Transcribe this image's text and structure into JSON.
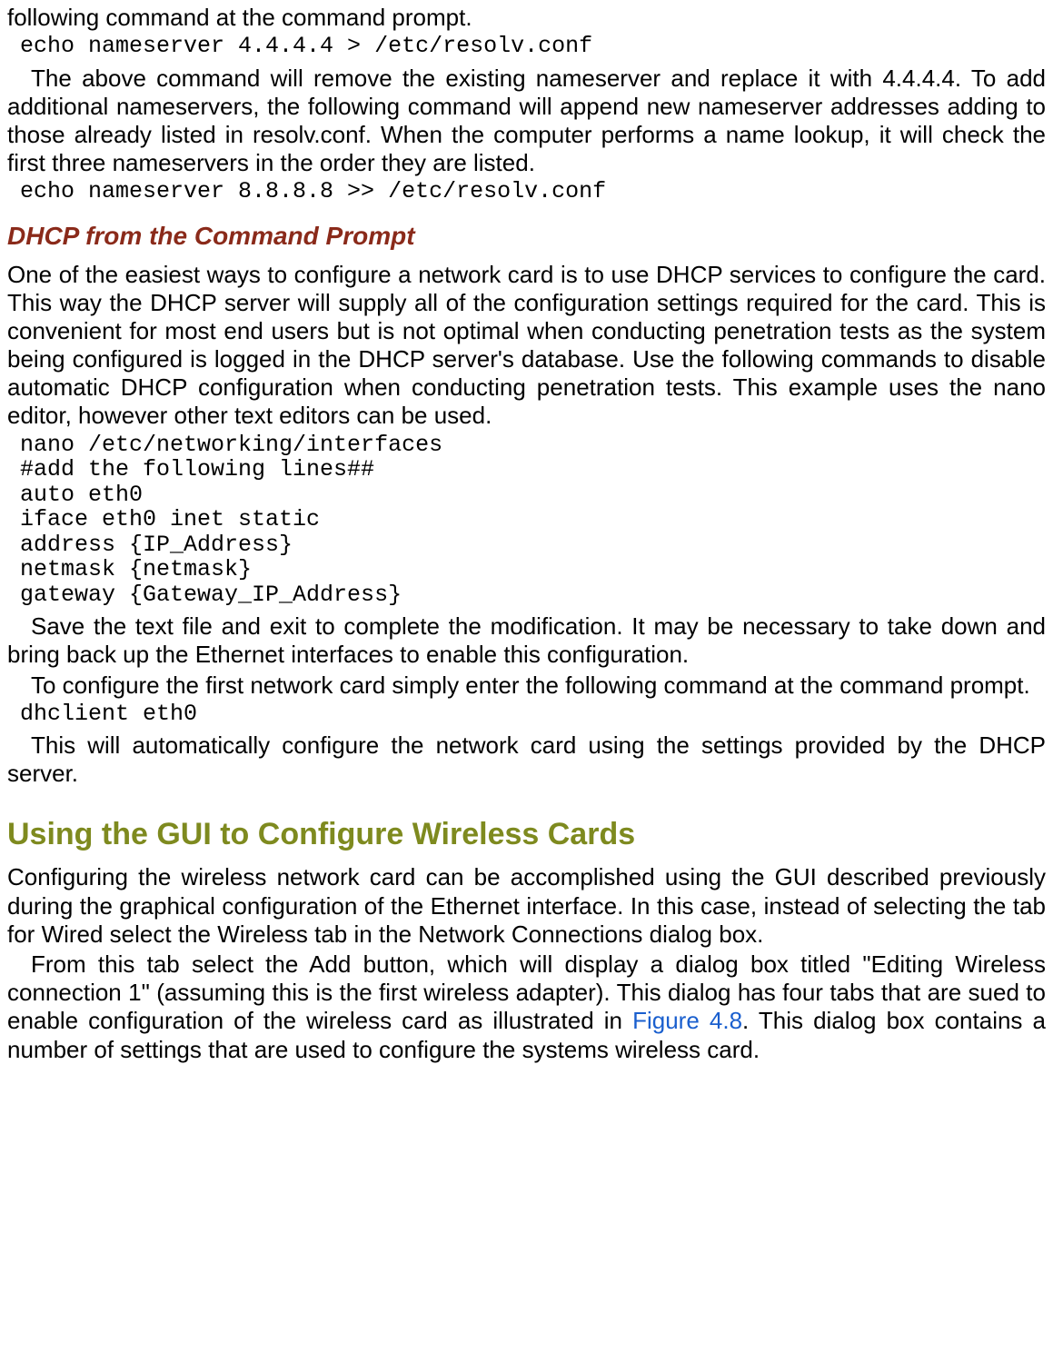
{
  "intro": {
    "p1": "following command at the command prompt.",
    "code1": "echo nameserver 4.4.4.4 > /etc/resolv.conf",
    "p2": "The above command will remove the existing nameserver and replace it with 4.4.4.4. To add additional nameservers, the following command will append new nameserver addresses adding to those already listed in resolv.conf. When the computer performs a name lookup, it will check the first three nameservers in the order they are listed.",
    "code2": "echo nameserver 8.8.8.8 >> /etc/resolv.conf"
  },
  "dhcp": {
    "heading": "DHCP from the Command Prompt",
    "p1": "One of the easiest ways to configure a network card is to use DHCP services to configure the card. This way the DHCP server will supply all of the configuration settings required for the card. This is convenient for most end users but is not optimal when conducting penetration tests as the system being configured is logged in the DHCP server's database. Use the following commands to disable automatic DHCP configuration when conducting penetration tests. This example uses the nano editor, however other text editors can be used.",
    "code1": "nano /etc/networking/interfaces\n#add the following lines##\nauto eth0\niface eth0 inet static\naddress {IP_Address}\nnetmask {netmask}\ngateway {Gateway_IP_Address}",
    "p2": "Save the text file and exit to complete the modification. It may be necessary to take down and bring back up the Ethernet interfaces to enable this configuration.",
    "p3": "To configure the first network card simply enter the following command at the command prompt.",
    "code2": "dhclient eth0",
    "p4": "This will automatically configure the network card using the settings provided by the DHCP server."
  },
  "gui": {
    "heading": "Using the GUI to Configure Wireless Cards",
    "p1": "Configuring the wireless network card can be accomplished using the GUI described previously during the graphical configuration of the Ethernet interface. In this case, instead of selecting the tab for Wired select the Wireless tab in the Network Connections dialog box.",
    "p2a": "From this tab select the Add button, which will display a dialog box titled \"Editing Wireless connection 1\" (assuming this is the first wireless adapter). This dialog has four tabs that are sued to enable configuration of the wireless card as illustrated in ",
    "figref": "Figure 4.8",
    "p2b": ". This dialog box contains a number of settings that are used to configure the systems wireless card."
  }
}
